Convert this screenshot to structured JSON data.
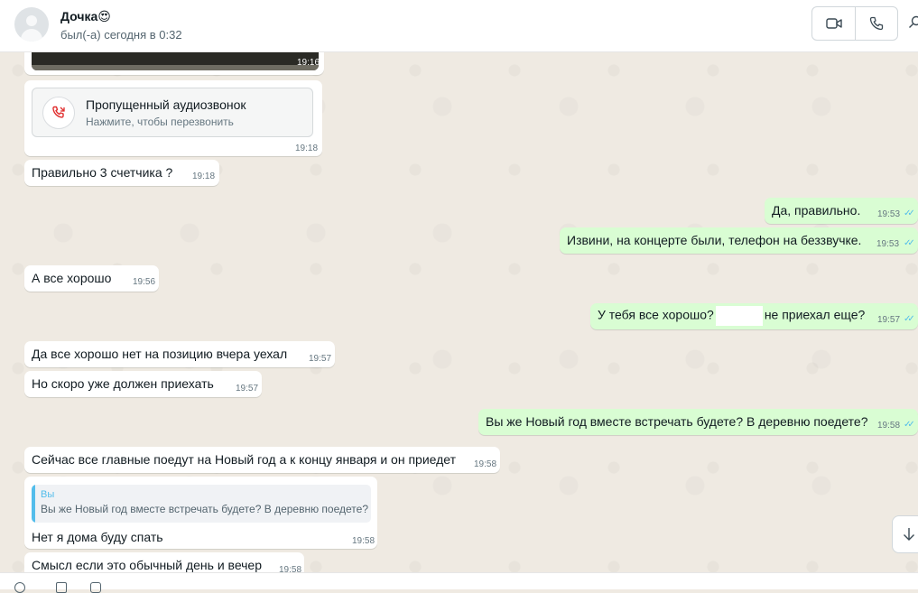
{
  "header": {
    "contact_name": "Дочка😍",
    "last_seen": "был(-а) сегодня в 0:32",
    "video_call_icon": "video-camera-icon",
    "voice_call_icon": "phone-icon",
    "search_icon": "search-icon"
  },
  "colors": {
    "incoming_bubble": "#ffffff",
    "outgoing_bubble": "#d9fdd3",
    "read_ticks": "#53bdeb",
    "missed_call_red": "#e02d2d",
    "chat_background": "#efeae2"
  },
  "messages": {
    "image_time": "19:16",
    "missed_call": {
      "title": "Пропущенный аудиозвонок",
      "subtitle": "Нажмите, чтобы перезвонить",
      "time": "19:18"
    },
    "m1": {
      "text": "Правильно 3 счетчика ?",
      "time": "19:18"
    },
    "m2": {
      "text": "Да, правильно.",
      "time": "19:53"
    },
    "m3": {
      "text": "Извини, на концерте были, телефон на беззвучке.",
      "time": "19:53"
    },
    "m4": {
      "text": "А все хорошо",
      "time": "19:56"
    },
    "m5": {
      "text_before": "У тебя все хорошо?",
      "text_after": "не приехал еще?",
      "time": "19:57"
    },
    "m6": {
      "text": "Да все хорошо нет на позицию вчера уехал",
      "time": "19:57"
    },
    "m7": {
      "text": "Но скоро уже должен приехать",
      "time": "19:57"
    },
    "m8": {
      "text": "Вы же Новый год вместе встречать будете? В деревню поедете?",
      "time": "19:58"
    },
    "m9": {
      "text": "Сейчас все главные поедут на Новый год а к концу января и он приедет",
      "time": "19:58"
    },
    "m10": {
      "quote_author": "Вы",
      "quote_text": "Вы же Новый год вместе встречать будете? В деревню поедете?",
      "text": "Нет я дома буду спать",
      "time": "19:58"
    },
    "m11": {
      "text": "Смысл если это обычный день и вечер",
      "time": "19:58"
    }
  }
}
